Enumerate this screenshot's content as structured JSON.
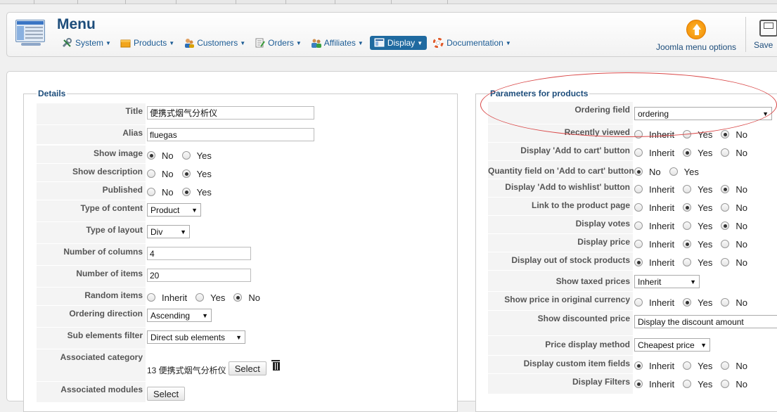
{
  "header": {
    "title": "Menu",
    "menu": [
      {
        "label": "System",
        "icon": "tools-icon"
      },
      {
        "label": "Products",
        "icon": "products-icon"
      },
      {
        "label": "Customers",
        "icon": "customers-icon"
      },
      {
        "label": "Orders",
        "icon": "orders-icon"
      },
      {
        "label": "Affiliates",
        "icon": "affiliates-icon"
      },
      {
        "label": "Display",
        "icon": "display-icon"
      },
      {
        "label": "Documentation",
        "icon": "lifebuoy-icon"
      }
    ],
    "joomla_options_label": "Joomla menu options",
    "save_label": "Save"
  },
  "details": {
    "legend": "Details",
    "title_label": "Title",
    "title_value": "便携式烟气分析仪",
    "alias_label": "Alias",
    "alias_value": "fluegas",
    "show_image_label": "Show image",
    "show_description_label": "Show description",
    "published_label": "Published",
    "type_content_label": "Type of content",
    "type_content_value": "Product",
    "type_layout_label": "Type of layout",
    "type_layout_value": "Div",
    "num_columns_label": "Number of columns",
    "num_columns_value": "4",
    "num_items_label": "Number of items",
    "num_items_value": "20",
    "random_items_label": "Random items",
    "ordering_direction_label": "Ordering direction",
    "ordering_direction_value": "Ascending",
    "sub_elements_label": "Sub elements filter",
    "sub_elements_value": "Direct sub elements",
    "assoc_category_label": "Associated category",
    "assoc_category_value": "13 便携式烟气分析仪",
    "assoc_modules_label": "Associated modules",
    "select_label": "Select",
    "opt_no": "No",
    "opt_yes": "Yes",
    "opt_inherit": "Inherit"
  },
  "params": {
    "legend": "Parameters for products",
    "ordering_field_label": "Ordering field",
    "ordering_field_value": "ordering",
    "recently_viewed_label": "Recently viewed",
    "add_to_cart_label": "Display 'Add to cart' button",
    "qty_field_label": "Quantity field on 'Add to cart' button",
    "wishlist_label": "Display 'Add to wishlist' button",
    "link_product_label": "Link to the product page",
    "votes_label": "Display votes",
    "price_label": "Display price",
    "out_of_stock_label": "Display out of stock products",
    "taxed_prices_label": "Show taxed prices",
    "taxed_prices_value": "Inherit",
    "orig_currency_label": "Show price in original currency",
    "discounted_label": "Show discounted price",
    "discounted_value": "Display the discount amount",
    "price_method_label": "Price display method",
    "price_method_value": "Cheapest price",
    "custom_fields_label": "Display custom item fields",
    "filters_label": "Display Filters",
    "opt_no": "No",
    "opt_yes": "Yes",
    "opt_inherit": "Inherit"
  },
  "colors": {
    "accent": "#1d4d7b",
    "active_menu": "#1f6aa0",
    "annotation": "#d94848"
  }
}
